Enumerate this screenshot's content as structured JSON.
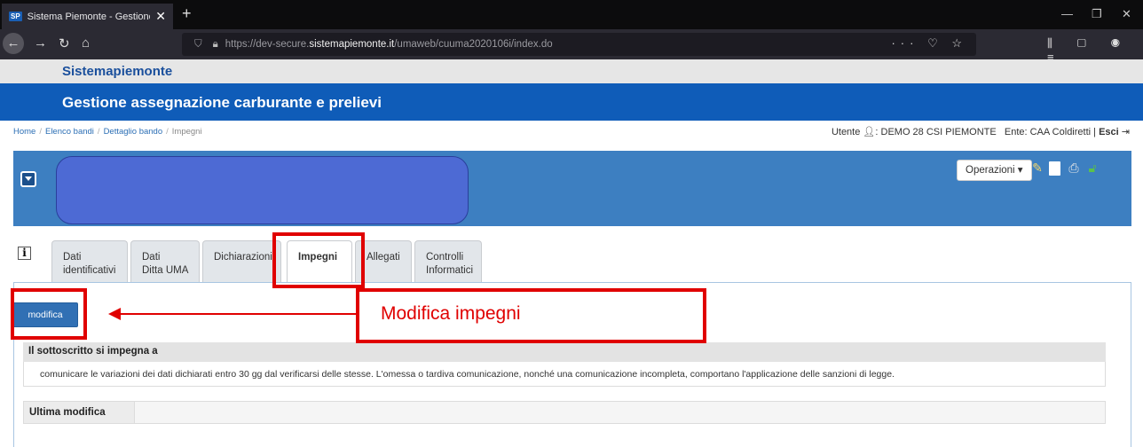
{
  "browser": {
    "tab_title": "Sistema Piemonte - Gestione a",
    "favicon": "SP",
    "url_prefix": "https://dev-secure.",
    "url_domain": "sistemapiemonte.it",
    "url_path": "/umaweb/cuuma2020106i/index.do"
  },
  "brand": "Sistemapiemonte",
  "app_title": "Gestione assegnazione carburante e prelievi",
  "breadcrumb": [
    "Home",
    "Elenco bandi",
    "Dettaglio bando",
    "Impegni"
  ],
  "user": {
    "prefix": "Utente",
    "name": ": DEMO 28 CSI PIEMONTE",
    "ente": "Ente: CAA Coldiretti",
    "sep": " | ",
    "logout": "Esci"
  },
  "toolbar": {
    "operazioni": "Operazioni ▾"
  },
  "tabs": [
    {
      "l1": "Dati",
      "l2": "identificativi"
    },
    {
      "l1": "Dati",
      "l2": "Ditta UMA"
    },
    {
      "l1": "Dichiarazioni",
      "l2": ""
    },
    {
      "l1": "Impegni",
      "l2": ""
    },
    {
      "l1": "Allegati",
      "l2": ""
    },
    {
      "l1": "Controlli",
      "l2": "Informatici"
    }
  ],
  "modifica_button": "modifica",
  "annotation": "Modifica impegni",
  "section": {
    "header": "Il sottoscritto si impegna a",
    "body": "comunicare le variazioni dei dati dichiarati entro 30 gg dal verificarsi delle stesse. L'omessa o tardiva comunicazione, nonché una comunicazione incompleta, comportano l'applicazione delle sanzioni di legge."
  },
  "ultima_modifica_label": "Ultima modifica",
  "colors": {
    "brand_blue": "#0f5cb8",
    "panel_blue": "#3d7fc1",
    "annotation_red": "#e00000"
  }
}
